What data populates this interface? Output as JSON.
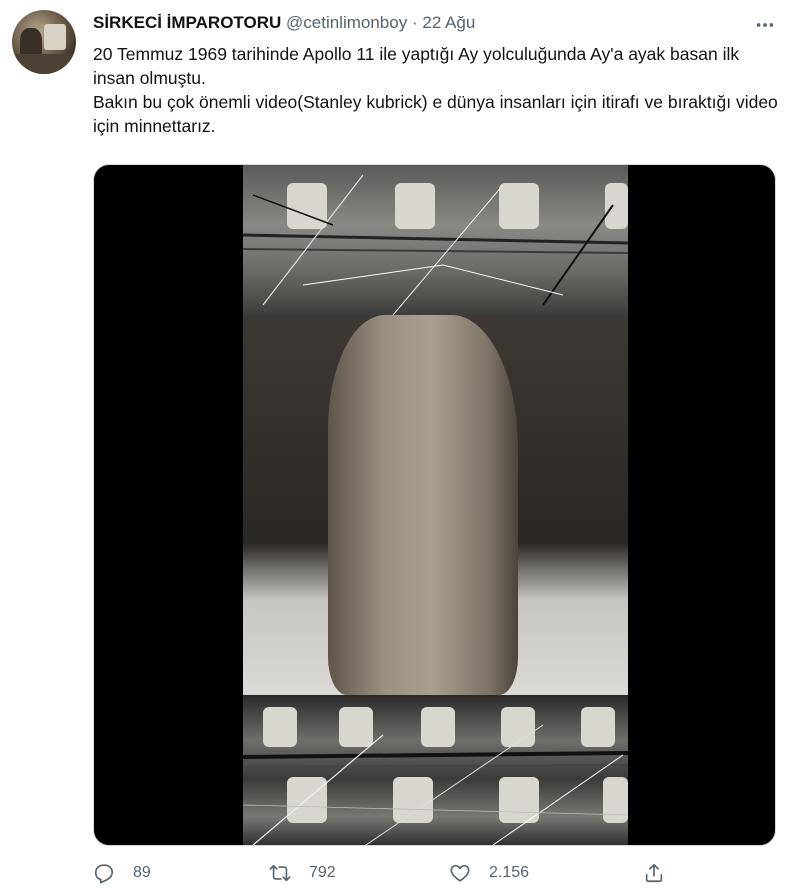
{
  "tweet": {
    "author_name": "SİRKECİ İMPAROTORU",
    "author_handle": "@cetinlimonboy",
    "separator": "·",
    "date": "22 Ağu",
    "text_lines": [
      "20 Temmuz 1969 tarihinde Apollo 11 ile yaptığı Ay yolculuğunda Ay'a ayak basan ilk insan olmuştu.",
      "Bakın bu çok önemli video(Stanley kubrick) e dünya insanları için itirafı ve bıraktığı video için minnettarız."
    ],
    "media_type": "video"
  },
  "actions": {
    "reply_count": "89",
    "retweet_count": "792",
    "like_count": "2.156"
  },
  "icons": {
    "more": "more-horizontal-icon",
    "reply": "reply-icon",
    "retweet": "retweet-icon",
    "like": "heart-icon",
    "share": "share-icon"
  },
  "colors": {
    "text_primary": "#0f1419",
    "text_secondary": "#536471",
    "media_border": "#cfd9de"
  }
}
